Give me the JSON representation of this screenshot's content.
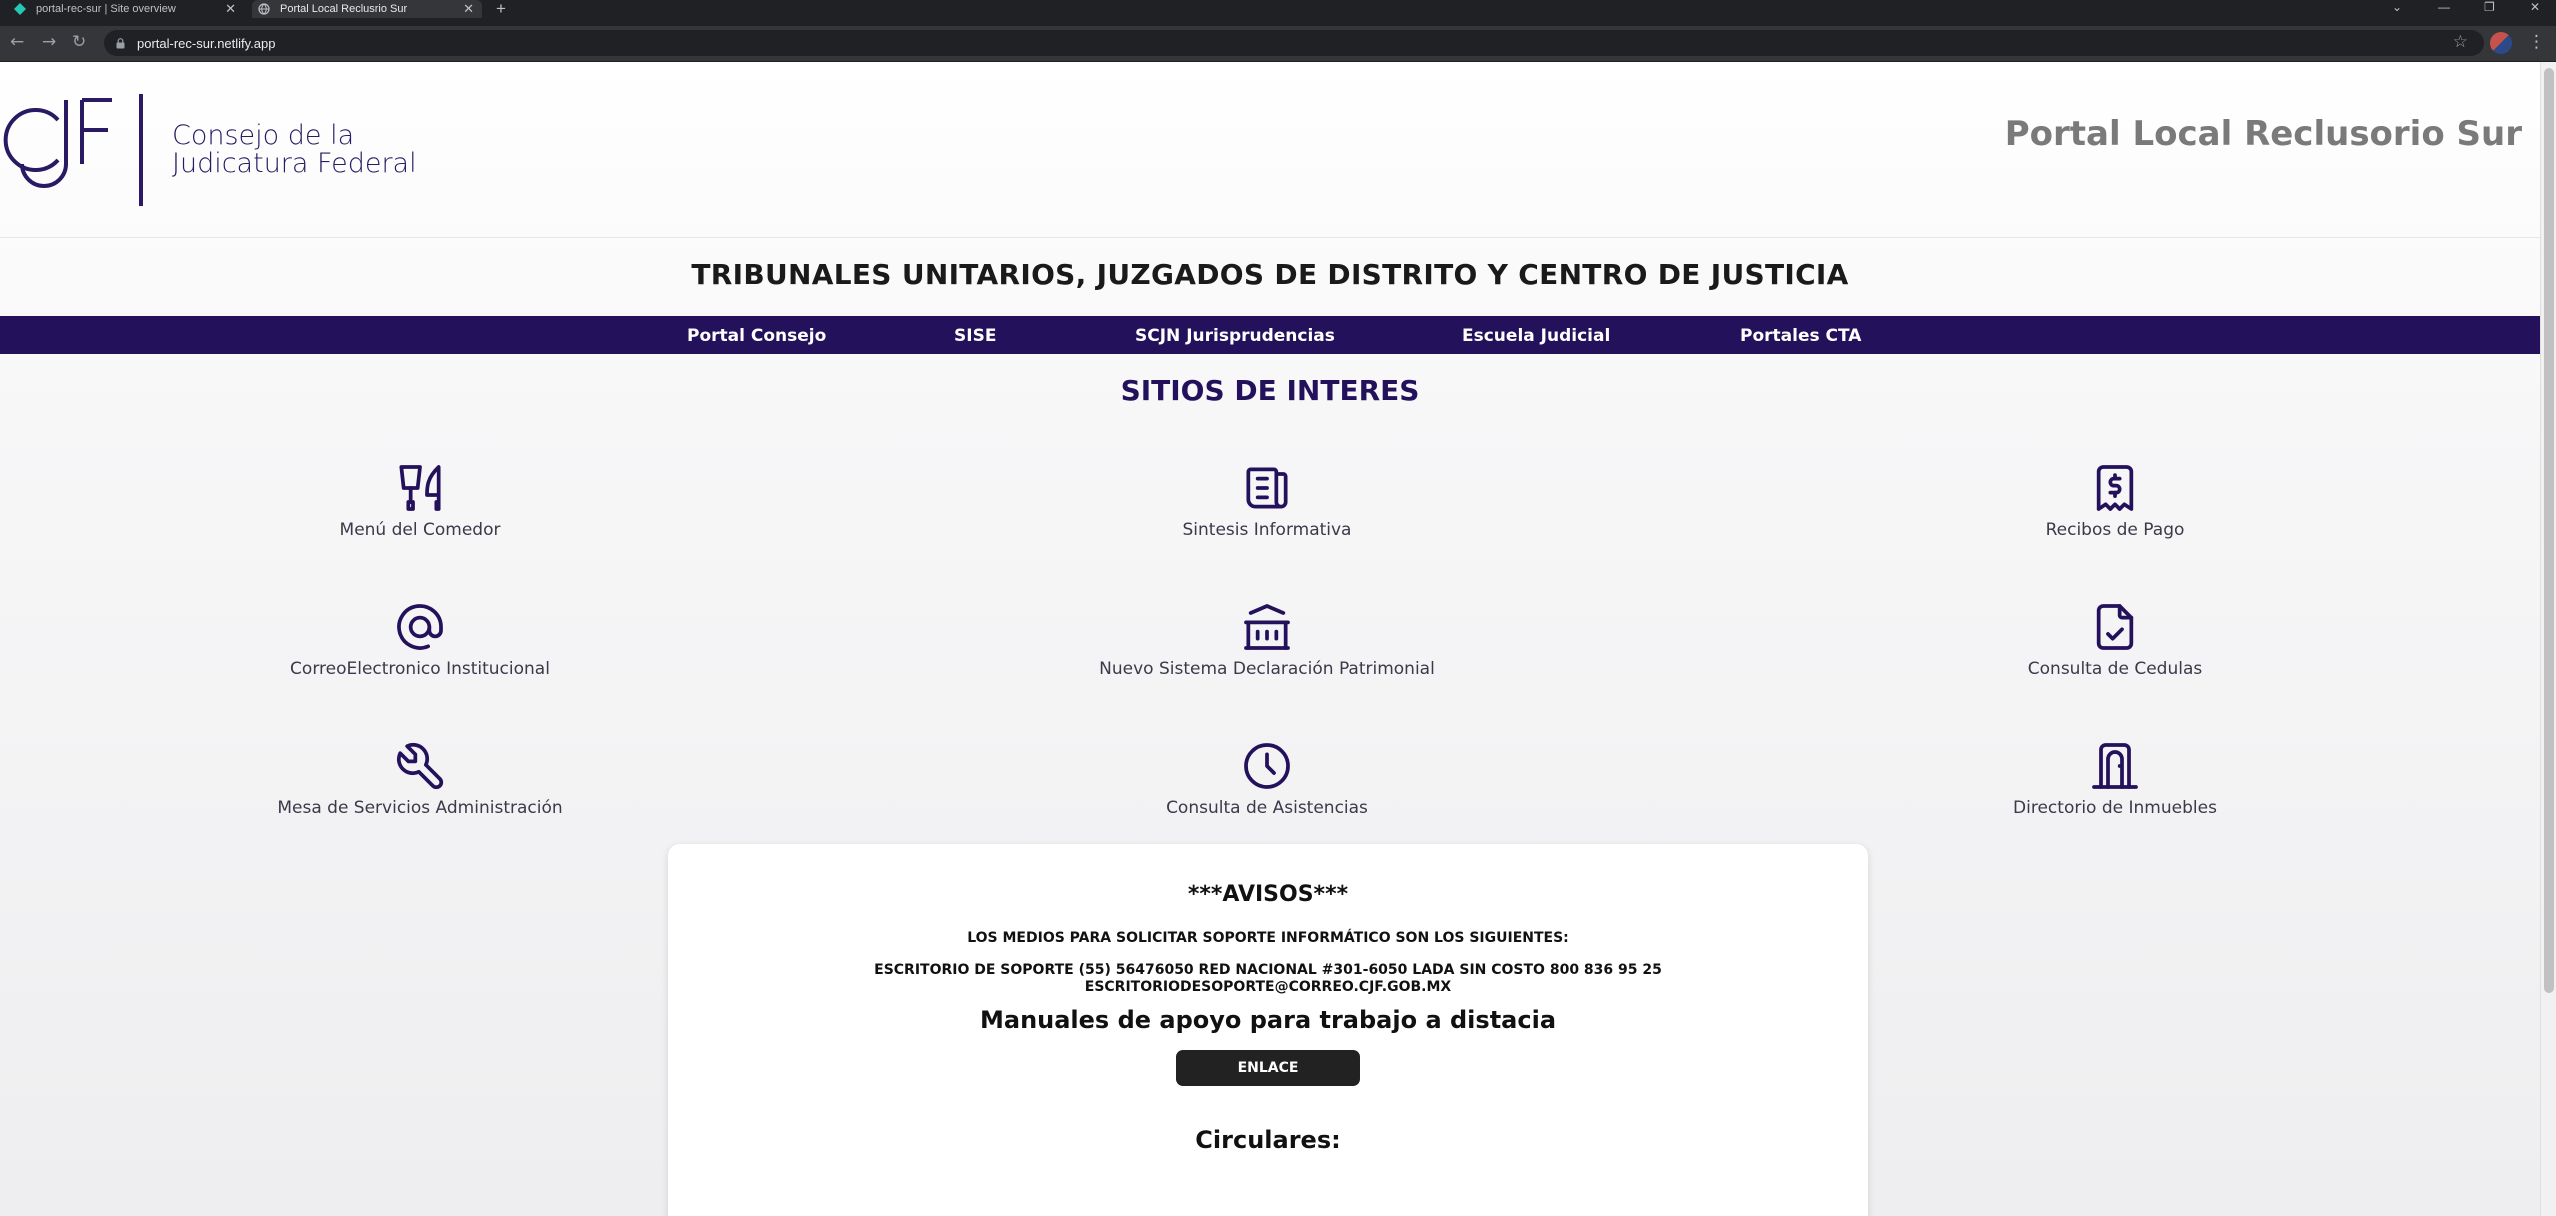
{
  "browser": {
    "tabs": [
      {
        "title": "portal-rec-sur | Site overview",
        "active": false
      },
      {
        "title": "Portal Local Reclusrio Sur",
        "active": true
      }
    ],
    "url": "portal-rec-sur.netlify.app"
  },
  "header": {
    "logo_monogram": "CJF",
    "logo_line1": "Consejo de la",
    "logo_line2": "Judicatura Federal",
    "portal_title": "Portal Local Reclusorio Sur"
  },
  "subtitle": "TRIBUNALES UNITARIOS, JUZGADOS DE DISTRITO Y CENTRO DE JUSTICIA",
  "nav": {
    "items": [
      "Portal Consejo",
      "SISE",
      "SCJN Jurisprudencias",
      "Escuela Judicial",
      "Portales CTA"
    ]
  },
  "sites": {
    "title": "SITIOS DE INTERES",
    "items": [
      {
        "label": "Menú del Comedor",
        "icon": "tools-kitchen-icon"
      },
      {
        "label": "Sintesis Informativa",
        "icon": "news-icon"
      },
      {
        "label": "Recibos de Pago",
        "icon": "receipt-icon"
      },
      {
        "label": "CorreoElectronico Institucional",
        "icon": "at-sign-icon"
      },
      {
        "label": "Nuevo Sistema Declaración Patrimonial",
        "icon": "building-bank-icon"
      },
      {
        "label": "Consulta de Cedulas",
        "icon": "file-check-icon"
      },
      {
        "label": "Mesa de Servicios Administración",
        "icon": "wrench-icon"
      },
      {
        "label": "Consulta de Asistencias",
        "icon": "clock-icon"
      },
      {
        "label": "Directorio de Inmuebles",
        "icon": "door-icon"
      }
    ]
  },
  "avisos": {
    "title": "***AVISOS***",
    "line1": "LOS MEDIOS PARA SOLICITAR SOPORTE INFORMÁTICO SON LOS SIGUIENTES:",
    "line2": "ESCRITORIO DE SOPORTE (55) 56476050 RED NACIONAL #301-6050 LADA SIN COSTO 800 836 95 25",
    "line3": "ESCRITORIODESOPORTE@CORREO.CJF.GOB.MX",
    "manuals_title": "Manuales de apoyo para trabajo a distacia",
    "button_label": "ENLACE",
    "circulares_title": "Circulares:"
  },
  "colors": {
    "brand_purple": "#24115c",
    "portal_title_gray": "#7a7a7a",
    "button_dark": "#222222"
  }
}
